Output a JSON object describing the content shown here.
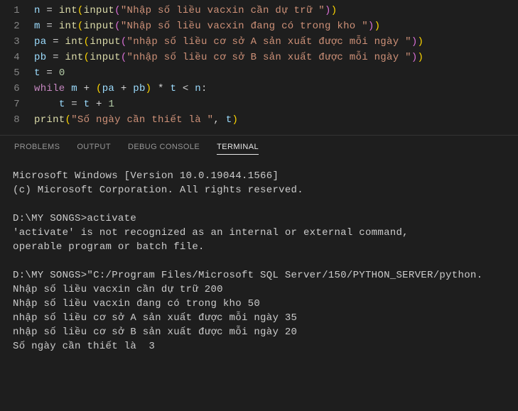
{
  "code": {
    "lines": [
      {
        "num": "1",
        "tokens": [
          {
            "c": "tok-var",
            "t": "n"
          },
          {
            "c": "tok-op",
            "t": " = "
          },
          {
            "c": "tok-func",
            "t": "int"
          },
          {
            "c": "tok-paren",
            "t": "("
          },
          {
            "c": "tok-func",
            "t": "input"
          },
          {
            "c": "tok-paren2",
            "t": "("
          },
          {
            "c": "tok-str",
            "t": "\"Nhập số liều vacxin cần dự trữ \""
          },
          {
            "c": "tok-paren2",
            "t": ")"
          },
          {
            "c": "tok-paren",
            "t": ")"
          }
        ]
      },
      {
        "num": "2",
        "tokens": [
          {
            "c": "tok-var",
            "t": "m"
          },
          {
            "c": "tok-op",
            "t": " = "
          },
          {
            "c": "tok-func",
            "t": "int"
          },
          {
            "c": "tok-paren",
            "t": "("
          },
          {
            "c": "tok-func",
            "t": "input"
          },
          {
            "c": "tok-paren2",
            "t": "("
          },
          {
            "c": "tok-str",
            "t": "\"Nhập số liều vacxin đang có trong kho \""
          },
          {
            "c": "tok-paren2",
            "t": ")"
          },
          {
            "c": "tok-paren",
            "t": ")"
          }
        ]
      },
      {
        "num": "3",
        "tokens": [
          {
            "c": "tok-var",
            "t": "pa"
          },
          {
            "c": "tok-op",
            "t": " = "
          },
          {
            "c": "tok-func",
            "t": "int"
          },
          {
            "c": "tok-paren",
            "t": "("
          },
          {
            "c": "tok-func",
            "t": "input"
          },
          {
            "c": "tok-paren2",
            "t": "("
          },
          {
            "c": "tok-str",
            "t": "\"nhập số liều cơ sở A sản xuất được mỗi ngày \""
          },
          {
            "c": "tok-paren2",
            "t": ")"
          },
          {
            "c": "tok-paren",
            "t": ")"
          }
        ]
      },
      {
        "num": "4",
        "tokens": [
          {
            "c": "tok-var",
            "t": "pb"
          },
          {
            "c": "tok-op",
            "t": " = "
          },
          {
            "c": "tok-func",
            "t": "int"
          },
          {
            "c": "tok-paren",
            "t": "("
          },
          {
            "c": "tok-func",
            "t": "input"
          },
          {
            "c": "tok-paren2",
            "t": "("
          },
          {
            "c": "tok-str",
            "t": "\"nhập số liều cơ sở B sản xuất được mỗi ngày \""
          },
          {
            "c": "tok-paren2",
            "t": ")"
          },
          {
            "c": "tok-paren",
            "t": ")"
          }
        ]
      },
      {
        "num": "5",
        "tokens": [
          {
            "c": "tok-var",
            "t": "t"
          },
          {
            "c": "tok-op",
            "t": " = "
          },
          {
            "c": "tok-num",
            "t": "0"
          }
        ]
      },
      {
        "num": "6",
        "tokens": [
          {
            "c": "tok-kw",
            "t": "while"
          },
          {
            "c": "tok-op",
            "t": " "
          },
          {
            "c": "tok-var",
            "t": "m"
          },
          {
            "c": "tok-op",
            "t": " + "
          },
          {
            "c": "tok-paren",
            "t": "("
          },
          {
            "c": "tok-var",
            "t": "pa"
          },
          {
            "c": "tok-op",
            "t": " + "
          },
          {
            "c": "tok-var",
            "t": "pb"
          },
          {
            "c": "tok-paren",
            "t": ")"
          },
          {
            "c": "tok-op",
            "t": " * "
          },
          {
            "c": "tok-var",
            "t": "t"
          },
          {
            "c": "tok-op",
            "t": " < "
          },
          {
            "c": "tok-var",
            "t": "n"
          },
          {
            "c": "tok-op",
            "t": ":"
          }
        ]
      },
      {
        "num": "7",
        "indent": "    ",
        "tokens": [
          {
            "c": "tok-var",
            "t": "t"
          },
          {
            "c": "tok-op",
            "t": " = "
          },
          {
            "c": "tok-var",
            "t": "t"
          },
          {
            "c": "tok-op",
            "t": " + "
          },
          {
            "c": "tok-num",
            "t": "1"
          }
        ]
      },
      {
        "num": "8",
        "tokens": [
          {
            "c": "tok-func",
            "t": "print"
          },
          {
            "c": "tok-paren",
            "t": "("
          },
          {
            "c": "tok-str",
            "t": "\"Số ngày cần thiết là \""
          },
          {
            "c": "tok-op",
            "t": ", "
          },
          {
            "c": "tok-var",
            "t": "t"
          },
          {
            "c": "tok-paren",
            "t": ")"
          }
        ]
      }
    ]
  },
  "panel": {
    "tabs": [
      {
        "label": "PROBLEMS",
        "active": false
      },
      {
        "label": "OUTPUT",
        "active": false
      },
      {
        "label": "DEBUG CONSOLE",
        "active": false
      },
      {
        "label": "TERMINAL",
        "active": true
      }
    ]
  },
  "terminal": {
    "lines": [
      "Microsoft Windows [Version 10.0.19044.1566]",
      "(c) Microsoft Corporation. All rights reserved.",
      "",
      "D:\\MY SONGS>activate",
      "'activate' is not recognized as an internal or external command,",
      "operable program or batch file.",
      "",
      "D:\\MY SONGS>\"C:/Program Files/Microsoft SQL Server/150/PYTHON_SERVER/python.",
      "Nhập số liều vacxin cần dự trữ 200",
      "Nhập số liều vacxin đang có trong kho 50",
      "nhập số liều cơ sở A sản xuất được mỗi ngày 35",
      "nhập số liều cơ sở B sản xuất được mỗi ngày 20",
      "Số ngày cần thiết là  3"
    ]
  }
}
